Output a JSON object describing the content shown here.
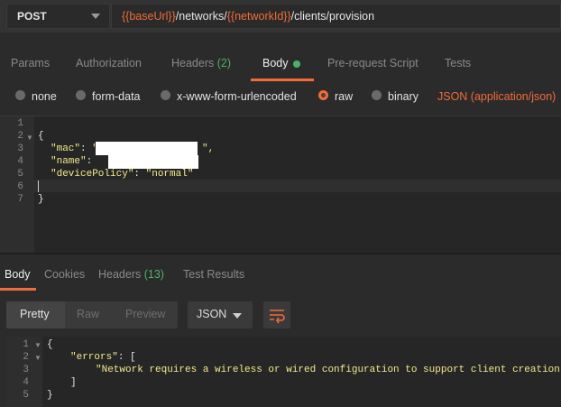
{
  "request": {
    "method": "POST",
    "url": {
      "base_var": "{{baseUrl}}",
      "seg1": "/networks/",
      "network_var": "{{networkId}}",
      "seg2": "/clients/provision"
    }
  },
  "request_tabs": [
    {
      "label": "Params"
    },
    {
      "label": "Authorization"
    },
    {
      "label": "Headers",
      "count": "(2)"
    },
    {
      "label": "Body"
    },
    {
      "label": "Pre-request Script"
    },
    {
      "label": "Tests"
    }
  ],
  "body_types": [
    {
      "label": "none"
    },
    {
      "label": "form-data"
    },
    {
      "label": "x-www-form-urlencoded"
    },
    {
      "label": "raw",
      "selected": true
    },
    {
      "label": "binary"
    }
  ],
  "content_type": "JSON (application/json)",
  "request_body": {
    "line_numbers": [
      "1",
      "2",
      "3",
      "4",
      "5",
      "6",
      "7"
    ],
    "open_brace": "{",
    "mac_key": "\"mac\"",
    "mac_colon": ": ",
    "mac_value_prefix": "\"",
    "mac_value_suffix": "\",",
    "name_key": "\"name\"",
    "name_colon": ":",
    "policy_key": "\"devicePolicy\"",
    "policy_colon": ": ",
    "policy_value": "\"normal\"",
    "close_brace": "}"
  },
  "response_tabs": [
    {
      "label": "Body"
    },
    {
      "label": "Cookies"
    },
    {
      "label": "Headers",
      "count": "(13)"
    },
    {
      "label": "Test Results"
    }
  ],
  "view_modes": [
    "Pretty",
    "Raw",
    "Preview"
  ],
  "format": "JSON",
  "response_body": {
    "line_numbers": [
      "1",
      "2",
      "3",
      "4",
      "5"
    ],
    "open_brace": "{",
    "errors_key": "\"errors\"",
    "errors_colon": ": [",
    "message": "\"Network requires a wireless or wired configuration to support client creation\"",
    "close_bracket": "]",
    "close_brace": "}"
  },
  "colors": {
    "accent": "#f26b3a",
    "count": "#4cb26a",
    "string": "#f3e98b"
  },
  "icons": [
    "chevron-down-icon",
    "wrap-lines-icon",
    "fold-arrow-icon"
  ]
}
